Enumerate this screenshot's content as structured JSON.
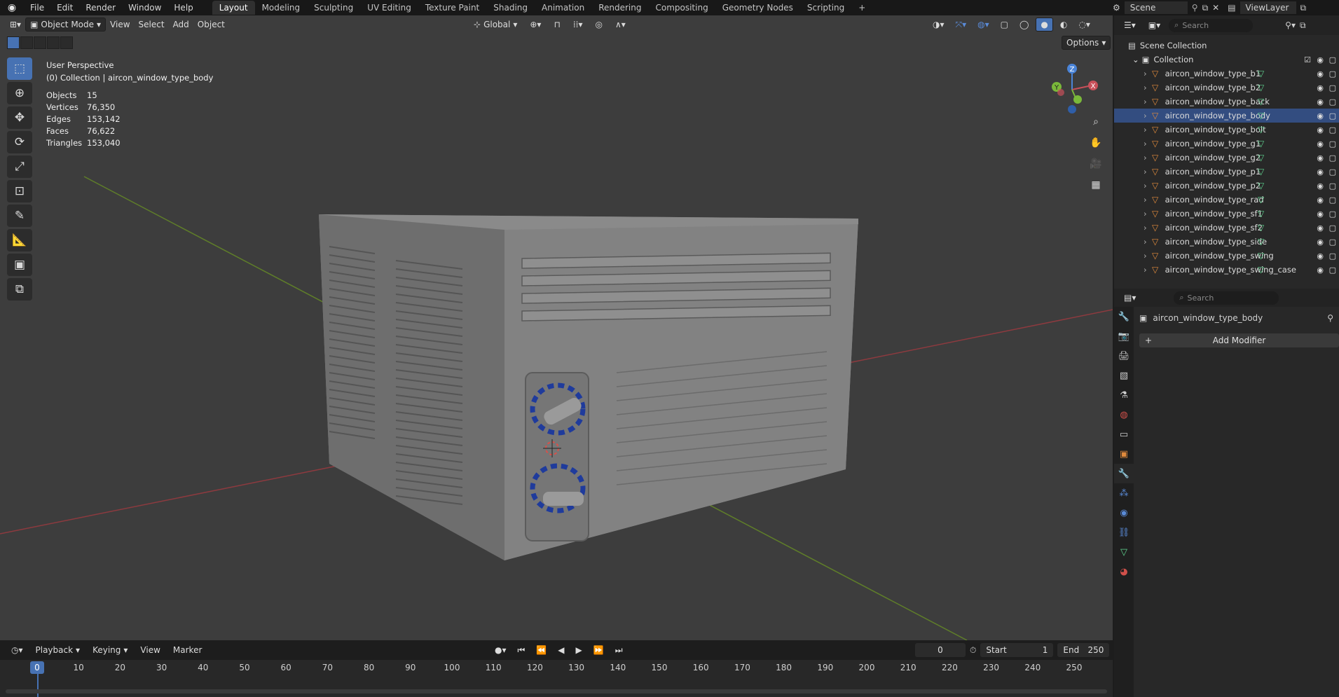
{
  "topbar": {
    "menus": [
      "File",
      "Edit",
      "Render",
      "Window",
      "Help"
    ],
    "workspaces": [
      "Layout",
      "Modeling",
      "Sculpting",
      "UV Editing",
      "Texture Paint",
      "Shading",
      "Animation",
      "Rendering",
      "Compositing",
      "Geometry Nodes",
      "Scripting"
    ],
    "active_workspace": "Layout",
    "scene_label": "Scene",
    "viewlayer_label": "ViewLayer"
  },
  "viewport": {
    "mode": "Object Mode",
    "menus": [
      "View",
      "Select",
      "Add",
      "Object"
    ],
    "transform_orientation": "Global",
    "options_label": "Options",
    "perspective_label": "User Perspective",
    "context_label": "(0) Collection | aircon_window_type_body",
    "stats": [
      {
        "label": "Objects",
        "value": "15"
      },
      {
        "label": "Vertices",
        "value": "76,350"
      },
      {
        "label": "Edges",
        "value": "153,142"
      },
      {
        "label": "Faces",
        "value": "76,622"
      },
      {
        "label": "Triangles",
        "value": "153,040"
      }
    ],
    "gizmo_axes": [
      "Z",
      "Y",
      "X"
    ]
  },
  "timeline": {
    "menus": [
      "Playback",
      "Keying",
      "View",
      "Marker"
    ],
    "current_frame": "0",
    "start_label": "Start",
    "start_value": "1",
    "end_label": "End",
    "end_value": "250",
    "ticks": [
      "0",
      "10",
      "20",
      "30",
      "40",
      "50",
      "60",
      "70",
      "80",
      "90",
      "100",
      "110",
      "120",
      "130",
      "140",
      "150",
      "160",
      "170",
      "180",
      "190",
      "200",
      "210",
      "220",
      "230",
      "240",
      "250"
    ]
  },
  "outliner": {
    "search_placeholder": "Search",
    "scene_collection": "Scene Collection",
    "collection": "Collection",
    "objects": [
      "aircon_window_type_b1",
      "aircon_window_type_b2",
      "aircon_window_type_back",
      "aircon_window_type_body",
      "aircon_window_type_bolt",
      "aircon_window_type_g1",
      "aircon_window_type_g2",
      "aircon_window_type_p1",
      "aircon_window_type_p2",
      "aircon_window_type_rad",
      "aircon_window_type_sf1",
      "aircon_window_type_sf2",
      "aircon_window_type_side",
      "aircon_window_type_swing",
      "aircon_window_type_swing_case"
    ],
    "selected_object": "aircon_window_type_body"
  },
  "properties": {
    "search_placeholder": "Search",
    "object_name": "aircon_window_type_body",
    "add_modifier_label": "Add Modifier"
  },
  "colors": {
    "accent": "#4772b3",
    "viewport_bg": "#3d3d3d",
    "object_icon": "#e08a3c",
    "mesh_icon": "#5fd38f",
    "x_axis": "#c8505a",
    "y_axis": "#7ab83a",
    "z_axis": "#4a84d8"
  }
}
